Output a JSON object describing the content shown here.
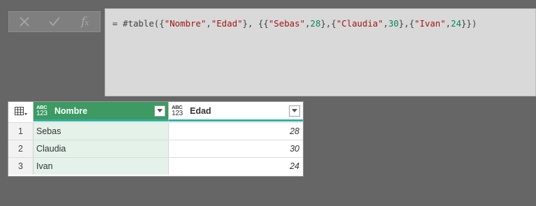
{
  "formula_bar": {
    "buttons": [
      {
        "name": "cancel",
        "icon": "close-icon"
      },
      {
        "name": "commit",
        "icon": "check-icon"
      },
      {
        "name": "insert-function",
        "icon": "fx-icon",
        "label": "fx"
      }
    ],
    "formula_text": "= #table({\"Nombre\",\"Edad\"}, {{\"Sebas\",28},{\"Claudia\",30},{\"Ivan\",24}})",
    "formula_tokens": [
      {
        "t": "= #table({",
        "k": "op"
      },
      {
        "t": "\"Nombre\"",
        "k": "str"
      },
      {
        "t": ",",
        "k": "op"
      },
      {
        "t": "\"Edad\"",
        "k": "str"
      },
      {
        "t": "}, {{",
        "k": "op"
      },
      {
        "t": "\"Sebas\"",
        "k": "str"
      },
      {
        "t": ",",
        "k": "op"
      },
      {
        "t": "28",
        "k": "num"
      },
      {
        "t": "},{",
        "k": "op"
      },
      {
        "t": "\"Claudia\"",
        "k": "str"
      },
      {
        "t": ",",
        "k": "op"
      },
      {
        "t": "30",
        "k": "num"
      },
      {
        "t": "},{",
        "k": "op"
      },
      {
        "t": "\"Ivan\"",
        "k": "str"
      },
      {
        "t": ",",
        "k": "op"
      },
      {
        "t": "24",
        "k": "num"
      },
      {
        "t": "}})",
        "k": "op"
      }
    ]
  },
  "table": {
    "corner_icon": "table-menu-icon",
    "columns": [
      {
        "name": "Nombre",
        "type_icon_top": "ABC",
        "type_icon_bottom": "123",
        "selected": true
      },
      {
        "name": "Edad",
        "type_icon_top": "ABC",
        "type_icon_bottom": "123",
        "selected": false
      }
    ],
    "rows": [
      {
        "num": "1",
        "nombre": "Sebas",
        "edad": "28"
      },
      {
        "num": "2",
        "nombre": "Claudia",
        "edad": "30"
      },
      {
        "num": "3",
        "nombre": "Ivan",
        "edad": "24"
      }
    ]
  },
  "colors": {
    "background": "#666666",
    "formula_bg": "#d9d9d9",
    "selected_header": "#3c9a62",
    "selected_column_cells": "#e4f2e9",
    "header_underline": "#2fb3a4",
    "string_literal": "#a31515",
    "number_literal": "#098658"
  }
}
